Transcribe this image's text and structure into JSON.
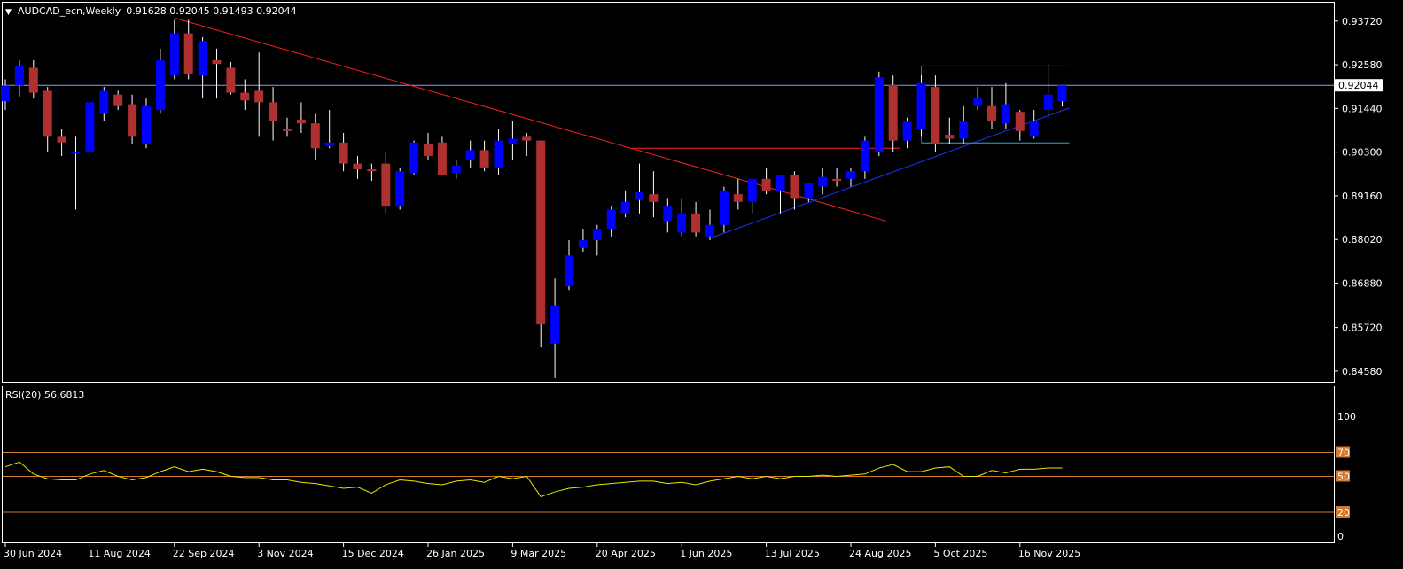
{
  "header": {
    "symbol": "AUDCAD_ecn,Weekly",
    "ohlc": "0.91628 0.92045 0.91493 0.92044"
  },
  "rsi_label": "RSI(20) 56.6813",
  "current_price_label": "0.92044",
  "colors": {
    "background": "#000000",
    "bull": "#0000ff",
    "bear": "#b03030",
    "wick": "#ffffff",
    "grid_price_line": "#7f9fff",
    "rsi_line": "#e8e800",
    "rsi_levels": "#d4782c",
    "downtrend": "#ff2020",
    "uptrend": "#2030ff",
    "resistance": "#ff2020",
    "support": "#20b0d0"
  },
  "chart_data": [
    {
      "type": "candlestick",
      "title": "AUDCAD_ecn,Weekly",
      "y_ticks": [
        "0.93720",
        "0.92580",
        "0.91440",
        "0.90300",
        "0.89160",
        "0.88020",
        "0.86880",
        "0.85720",
        "0.84580"
      ],
      "x_ticks": [
        "30 Jun 2024",
        "11 Aug 2024",
        "22 Sep 2024",
        "3 Nov 2024",
        "15 Dec 2024",
        "26 Jan 2025",
        "9 Mar 2025",
        "20 Apr 2025",
        "1 Jun 2025",
        "13 Jul 2025",
        "24 Aug 2025",
        "5 Oct 2025",
        "16 Nov 2025"
      ],
      "ylim": [
        0.843,
        0.942
      ],
      "last_price": 0.92044,
      "candles": [
        {
          "o": 0.9163,
          "h": 0.922,
          "l": 0.914,
          "c": 0.9204
        },
        {
          "o": 0.9204,
          "h": 0.927,
          "l": 0.9175,
          "c": 0.9255
        },
        {
          "o": 0.925,
          "h": 0.927,
          "l": 0.917,
          "c": 0.9185
        },
        {
          "o": 0.919,
          "h": 0.92,
          "l": 0.903,
          "c": 0.907
        },
        {
          "o": 0.907,
          "h": 0.909,
          "l": 0.902,
          "c": 0.9055
        },
        {
          "o": 0.903,
          "h": 0.907,
          "l": 0.888,
          "c": 0.903
        },
        {
          "o": 0.903,
          "h": 0.916,
          "l": 0.902,
          "c": 0.916
        },
        {
          "o": 0.913,
          "h": 0.92,
          "l": 0.911,
          "c": 0.919
        },
        {
          "o": 0.918,
          "h": 0.919,
          "l": 0.914,
          "c": 0.915
        },
        {
          "o": 0.9155,
          "h": 0.918,
          "l": 0.905,
          "c": 0.907
        },
        {
          "o": 0.905,
          "h": 0.917,
          "l": 0.904,
          "c": 0.915
        },
        {
          "o": 0.914,
          "h": 0.93,
          "l": 0.913,
          "c": 0.927
        },
        {
          "o": 0.923,
          "h": 0.9375,
          "l": 0.922,
          "c": 0.934
        },
        {
          "o": 0.934,
          "h": 0.9375,
          "l": 0.922,
          "c": 0.9235
        },
        {
          "o": 0.923,
          "h": 0.933,
          "l": 0.917,
          "c": 0.932
        },
        {
          "o": 0.927,
          "h": 0.93,
          "l": 0.917,
          "c": 0.926
        },
        {
          "o": 0.925,
          "h": 0.9265,
          "l": 0.918,
          "c": 0.9185
        },
        {
          "o": 0.9185,
          "h": 0.922,
          "l": 0.914,
          "c": 0.9165
        },
        {
          "o": 0.919,
          "h": 0.929,
          "l": 0.907,
          "c": 0.916
        },
        {
          "o": 0.916,
          "h": 0.92,
          "l": 0.906,
          "c": 0.911
        },
        {
          "o": 0.909,
          "h": 0.912,
          "l": 0.907,
          "c": 0.9085
        },
        {
          "o": 0.9115,
          "h": 0.916,
          "l": 0.908,
          "c": 0.9105
        },
        {
          "o": 0.9105,
          "h": 0.913,
          "l": 0.901,
          "c": 0.904
        },
        {
          "o": 0.9045,
          "h": 0.914,
          "l": 0.904,
          "c": 0.9055
        },
        {
          "o": 0.9055,
          "h": 0.908,
          "l": 0.898,
          "c": 0.9
        },
        {
          "o": 0.9,
          "h": 0.902,
          "l": 0.896,
          "c": 0.8985
        },
        {
          "o": 0.8985,
          "h": 0.9,
          "l": 0.8955,
          "c": 0.898
        },
        {
          "o": 0.9,
          "h": 0.903,
          "l": 0.887,
          "c": 0.889
        },
        {
          "o": 0.889,
          "h": 0.899,
          "l": 0.888,
          "c": 0.898
        },
        {
          "o": 0.8975,
          "h": 0.906,
          "l": 0.897,
          "c": 0.9055
        },
        {
          "o": 0.905,
          "h": 0.908,
          "l": 0.901,
          "c": 0.902
        },
        {
          "o": 0.9055,
          "h": 0.907,
          "l": 0.897,
          "c": 0.897
        },
        {
          "o": 0.8975,
          "h": 0.901,
          "l": 0.896,
          "c": 0.8995
        },
        {
          "o": 0.901,
          "h": 0.906,
          "l": 0.899,
          "c": 0.9035
        },
        {
          "o": 0.9035,
          "h": 0.906,
          "l": 0.898,
          "c": 0.899
        },
        {
          "o": 0.899,
          "h": 0.909,
          "l": 0.897,
          "c": 0.906
        },
        {
          "o": 0.905,
          "h": 0.911,
          "l": 0.901,
          "c": 0.9065
        },
        {
          "o": 0.907,
          "h": 0.908,
          "l": 0.902,
          "c": 0.906
        },
        {
          "o": 0.906,
          "h": 0.904,
          "l": 0.852,
          "c": 0.858
        },
        {
          "o": 0.853,
          "h": 0.87,
          "l": 0.844,
          "c": 0.863
        },
        {
          "o": 0.868,
          "h": 0.88,
          "l": 0.867,
          "c": 0.876
        },
        {
          "o": 0.878,
          "h": 0.883,
          "l": 0.877,
          "c": 0.88
        },
        {
          "o": 0.88,
          "h": 0.884,
          "l": 0.876,
          "c": 0.883
        },
        {
          "o": 0.883,
          "h": 0.889,
          "l": 0.881,
          "c": 0.888
        },
        {
          "o": 0.887,
          "h": 0.893,
          "l": 0.886,
          "c": 0.89
        },
        {
          "o": 0.8905,
          "h": 0.9,
          "l": 0.887,
          "c": 0.8925
        },
        {
          "o": 0.892,
          "h": 0.898,
          "l": 0.886,
          "c": 0.89
        },
        {
          "o": 0.885,
          "h": 0.891,
          "l": 0.882,
          "c": 0.889
        },
        {
          "o": 0.882,
          "h": 0.891,
          "l": 0.881,
          "c": 0.887
        },
        {
          "o": 0.887,
          "h": 0.89,
          "l": 0.881,
          "c": 0.882
        },
        {
          "o": 0.881,
          "h": 0.888,
          "l": 0.88,
          "c": 0.884
        },
        {
          "o": 0.884,
          "h": 0.894,
          "l": 0.882,
          "c": 0.893
        },
        {
          "o": 0.892,
          "h": 0.896,
          "l": 0.888,
          "c": 0.89
        },
        {
          "o": 0.89,
          "h": 0.896,
          "l": 0.887,
          "c": 0.896
        },
        {
          "o": 0.896,
          "h": 0.899,
          "l": 0.892,
          "c": 0.893
        },
        {
          "o": 0.893,
          "h": 0.897,
          "l": 0.887,
          "c": 0.897
        },
        {
          "o": 0.897,
          "h": 0.898,
          "l": 0.888,
          "c": 0.891
        },
        {
          "o": 0.891,
          "h": 0.895,
          "l": 0.89,
          "c": 0.895
        },
        {
          "o": 0.894,
          "h": 0.899,
          "l": 0.892,
          "c": 0.8965
        },
        {
          "o": 0.896,
          "h": 0.899,
          "l": 0.894,
          "c": 0.8955
        },
        {
          "o": 0.896,
          "h": 0.899,
          "l": 0.894,
          "c": 0.898
        },
        {
          "o": 0.898,
          "h": 0.907,
          "l": 0.896,
          "c": 0.906
        },
        {
          "o": 0.903,
          "h": 0.924,
          "l": 0.902,
          "c": 0.9225
        },
        {
          "o": 0.9205,
          "h": 0.923,
          "l": 0.903,
          "c": 0.906
        },
        {
          "o": 0.906,
          "h": 0.912,
          "l": 0.904,
          "c": 0.911
        },
        {
          "o": 0.909,
          "h": 0.923,
          "l": 0.907,
          "c": 0.921
        },
        {
          "o": 0.92,
          "h": 0.923,
          "l": 0.903,
          "c": 0.905
        },
        {
          "o": 0.9075,
          "h": 0.912,
          "l": 0.905,
          "c": 0.9065
        },
        {
          "o": 0.9065,
          "h": 0.915,
          "l": 0.905,
          "c": 0.911
        },
        {
          "o": 0.915,
          "h": 0.92,
          "l": 0.914,
          "c": 0.917
        },
        {
          "o": 0.915,
          "h": 0.92,
          "l": 0.909,
          "c": 0.911
        },
        {
          "o": 0.9105,
          "h": 0.921,
          "l": 0.909,
          "c": 0.9155
        },
        {
          "o": 0.9135,
          "h": 0.914,
          "l": 0.906,
          "c": 0.9085
        },
        {
          "o": 0.907,
          "h": 0.914,
          "l": 0.9065,
          "c": 0.911
        },
        {
          "o": 0.914,
          "h": 0.926,
          "l": 0.912,
          "c": 0.918
        },
        {
          "o": 0.9163,
          "h": 0.92045,
          "l": 0.91493,
          "c": 0.92044
        }
      ],
      "lines": {
        "downtrend": [
          [
            12,
            0.938
          ],
          [
            62.5,
            0.885
          ]
        ],
        "uptrend": [
          [
            50,
            0.8805
          ],
          [
            75.5,
            0.9145
          ]
        ],
        "resistance_low": [
          [
            44.5,
            0.904
          ],
          [
            63.5,
            0.904
          ]
        ],
        "resistance_high": [
          [
            65,
            0.9255
          ],
          [
            75.5,
            0.9255
          ]
        ],
        "support": [
          [
            65,
            0.9054
          ],
          [
            75.5,
            0.9054
          ]
        ]
      }
    },
    {
      "type": "line",
      "title": "RSI(20) 56.6813",
      "y_ticks": [
        "100",
        "70",
        "50",
        "20",
        "0"
      ],
      "levels": [
        70,
        50,
        20
      ],
      "ylim": [
        0,
        100
      ],
      "values": [
        58,
        62,
        52,
        48,
        47,
        47,
        52,
        55,
        50,
        47,
        49,
        54,
        58,
        54,
        56,
        54,
        50,
        49,
        49,
        47,
        47,
        45,
        44,
        42,
        40,
        41,
        36,
        43,
        47,
        46,
        44,
        43,
        46,
        47,
        45,
        50,
        48,
        50,
        33,
        37,
        40,
        41,
        43,
        44,
        45,
        46,
        46,
        44,
        45,
        43,
        46,
        48,
        50,
        48,
        50,
        48,
        50,
        50,
        51,
        50,
        51,
        52,
        57,
        60,
        54,
        54,
        57,
        58,
        50,
        50,
        55,
        53,
        56,
        56,
        57,
        57
      ],
      "last_value": 56.6813
    }
  ]
}
